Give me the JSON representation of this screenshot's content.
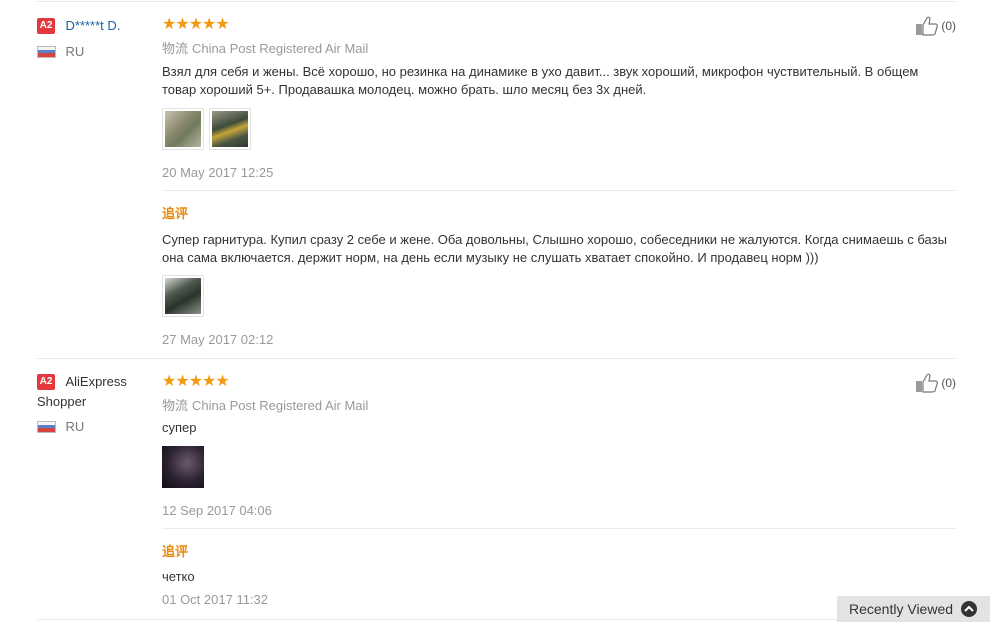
{
  "reviews": [
    {
      "badge": "A2",
      "user_name": "D*****t D.",
      "country": "RU",
      "stars": "★★★★★",
      "shipping_label": "物流",
      "shipping_method": "China Post Registered Air Mail",
      "text": "Взял для себя и жены. Всё хорошо, но резинка на динамике в ухо давит... звук хороший, микрофон чуствительный. В общем товар хороший 5+. Продавашка молодец. можно брать. шло месяц без 3х дней.",
      "date": "20 May 2017 12:25",
      "helpful_count": "(0)",
      "followup": {
        "label": "追评",
        "text": "Супер гарнитура. Купил сразу 2 себе и жене. Оба довольны, Слышно хорошо, собеседники не жалуются. Когда снимаешь с базы она сама включается. держит норм, на день если музыку не слушать хватает спокойно. И продавец норм )))",
        "date": "27 May 2017 02:12"
      }
    },
    {
      "badge": "A2",
      "user_name": "AliExpress Shopper",
      "country": "RU",
      "stars": "★★★★★",
      "shipping_label": "物流",
      "shipping_method": "China Post Registered Air Mail",
      "text": "супер",
      "date": "12 Sep 2017 04:06",
      "helpful_count": "(0)",
      "followup": {
        "label": "追评",
        "text": "четко",
        "date": "01 Oct 2017 11:32"
      }
    }
  ],
  "recently_viewed": {
    "label": "Recently Viewed"
  },
  "colors": {
    "stars": "#f39a13",
    "followup_label": "#e88a0c",
    "badge": "#e4393c",
    "user_link": "#1b5fa7"
  }
}
